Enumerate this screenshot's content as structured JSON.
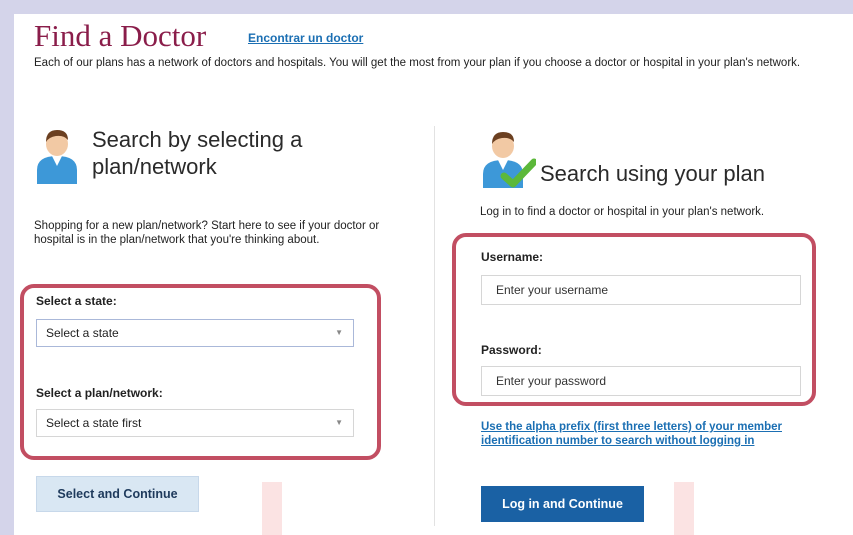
{
  "header": {
    "title": "Find a Doctor",
    "spanish_link": "Encontrar un doctor",
    "intro": "Each of our plans has a network of doctors and hospitals. You will get the most from your plan if you choose a doctor or hospital in your plan's network."
  },
  "left_section": {
    "heading": "Search by selecting a plan/network",
    "description": "Shopping for a new plan/network? Start here to see if your doctor or hospital is in the plan/network that you're thinking about.",
    "state_label": "Select a state:",
    "state_value": "Select a state",
    "plan_label": "Select a plan/network:",
    "plan_value": "Select a state first",
    "button": "Select and Continue"
  },
  "right_section": {
    "heading": "Search using your plan",
    "description": "Log in to find a doctor or hospital in your plan's network.",
    "username_label": "Username:",
    "username_placeholder": "Enter your username",
    "password_label": "Password:",
    "password_placeholder": "Enter your password",
    "member_link": "Use the alpha prefix (first three letters) of your member identification number to search without logging in",
    "button": "Log in and Continue"
  },
  "colors": {
    "title": "#8a1d4a",
    "link": "#1b6fb3",
    "highlight": "#c24e62",
    "primary_button": "#1a61a4",
    "secondary_button": "#d9e7f3",
    "checkmark": "#5cb83a"
  },
  "icons": {
    "left_person": "person-icon",
    "right_person": "person-check-icon",
    "dropdown": "chevron-down-icon"
  }
}
